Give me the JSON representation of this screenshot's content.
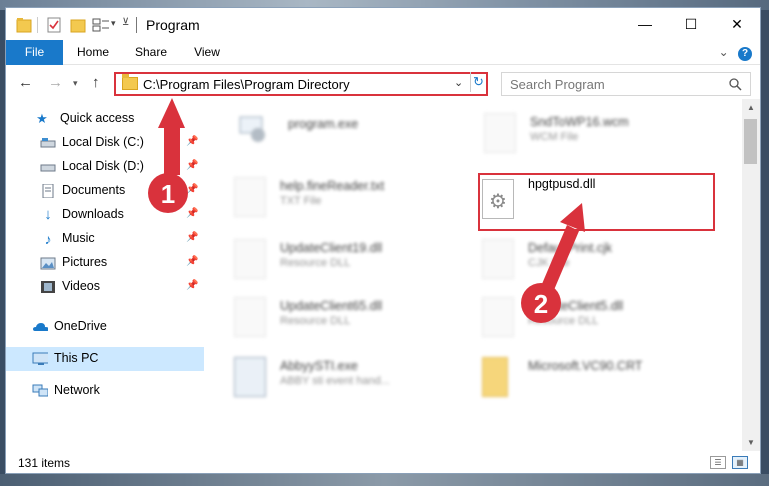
{
  "window": {
    "title": "Program",
    "controls": {
      "minimize": "—",
      "maximize": "☐",
      "close": "✕"
    }
  },
  "ribbon": {
    "tabs": [
      "File",
      "Home",
      "Share",
      "View"
    ],
    "expand": "⌄",
    "help": "?"
  },
  "address": {
    "path": "C:\\Program Files\\Program Directory",
    "search_placeholder": "Search Program"
  },
  "sidebar": {
    "items": [
      {
        "label": "Quick access",
        "icon": "star-icon"
      },
      {
        "label": "Local Disk (C:)",
        "icon": "drive-icon",
        "pinned": true
      },
      {
        "label": "Local Disk (D:)",
        "icon": "drive-icon",
        "pinned": true
      },
      {
        "label": "Documents",
        "icon": "documents-icon",
        "pinned": true
      },
      {
        "label": "Downloads",
        "icon": "downloads-icon",
        "pinned": true
      },
      {
        "label": "Music",
        "icon": "music-icon",
        "pinned": true
      },
      {
        "label": "Pictures",
        "icon": "pictures-icon",
        "pinned": true
      },
      {
        "label": "Videos",
        "icon": "videos-icon",
        "pinned": true
      },
      {
        "label": "OneDrive",
        "icon": "onedrive-icon"
      },
      {
        "label": "This PC",
        "icon": "computer-icon",
        "selected": true
      },
      {
        "label": "Network",
        "icon": "network-icon"
      }
    ]
  },
  "files": [
    {
      "name": "program.exe",
      "type": ""
    },
    {
      "name": "SndToWP16.wcm",
      "type": "WCM File"
    },
    {
      "name": "help.fineReader.txt",
      "type": "TXT File"
    },
    {
      "name": "hpgtpusd.dll",
      "type": "",
      "highlighted": true
    },
    {
      "name": "UpdateClient19.dll",
      "type": "Resource DLL"
    },
    {
      "name": "DefaultPrint.cjk",
      "type": "CJK File"
    },
    {
      "name": "UpdateClient65.dll",
      "type": "Resource DLL"
    },
    {
      "name": "UpdateClient5.dll",
      "type": "Resource DLL"
    },
    {
      "name": "AbbyySTI.exe",
      "type": "ABBY sti event hand..."
    },
    {
      "name": "Microsoft.VC90.CRT",
      "type": ""
    }
  ],
  "status": {
    "items": "131 items"
  },
  "annotations": {
    "step1": "1",
    "step2": "2"
  },
  "colors": {
    "accent": "#1979ca",
    "highlight": "#d9323c",
    "selected_bg": "#cce8ff"
  }
}
